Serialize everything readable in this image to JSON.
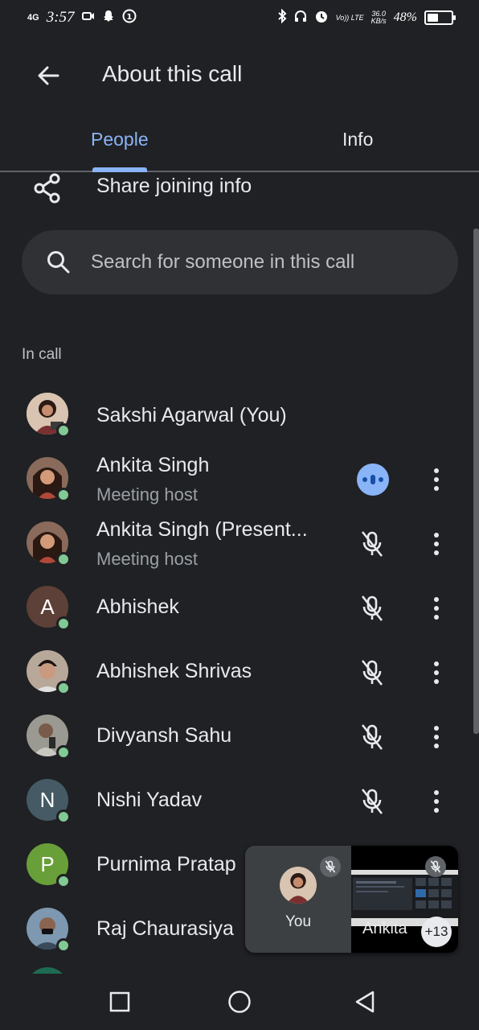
{
  "status_bar": {
    "network": "4G",
    "time": "3:57",
    "speed_value": "36.0",
    "speed_unit": "KB/s",
    "volte": "Vo)) LTE",
    "battery_pct": "48%",
    "battery_level": 0.48
  },
  "header": {
    "title": "About this call"
  },
  "tabs": [
    {
      "label": "People",
      "selected": true
    },
    {
      "label": "Info",
      "selected": false
    }
  ],
  "share": {
    "label": "Share joining info"
  },
  "search": {
    "placeholder": "Search for someone in this call"
  },
  "section_label": "In call",
  "participants": [
    {
      "name": "Sakshi Agarwal (You)",
      "role": "",
      "avatar": "photo",
      "mic": "none",
      "has_menu": false
    },
    {
      "name": "Ankita Singh",
      "role": "Meeting host",
      "avatar": "photo",
      "mic": "speaking",
      "has_menu": true
    },
    {
      "name": "Ankita Singh (Present...",
      "role": "Meeting host",
      "avatar": "photo",
      "mic": "muted",
      "has_menu": true
    },
    {
      "name": "Abhishek",
      "role": "",
      "avatar": "A",
      "avatar_color": "#5d4037",
      "mic": "muted",
      "has_menu": true
    },
    {
      "name": "Abhishek Shrivas",
      "role": "",
      "avatar": "photo",
      "mic": "muted",
      "has_menu": true
    },
    {
      "name": "Divyansh Sahu",
      "role": "",
      "avatar": "photo",
      "mic": "muted",
      "has_menu": true
    },
    {
      "name": "Nishi Yadav",
      "role": "",
      "avatar": "N",
      "avatar_color": "#455a64",
      "mic": "muted",
      "has_menu": true
    },
    {
      "name": "Purnima Pratap",
      "role": "",
      "avatar": "P",
      "avatar_color": "#689f38",
      "mic": "none",
      "has_menu": false
    },
    {
      "name": "Raj Chaurasiya",
      "role": "",
      "avatar": "photo",
      "mic": "none",
      "has_menu": false
    }
  ],
  "pip": {
    "self_label": "You",
    "other_label": "Ankita",
    "more_count": "+13"
  },
  "colors": {
    "background": "#202124",
    "accent": "#8ab4f8",
    "online": "#81c995"
  }
}
